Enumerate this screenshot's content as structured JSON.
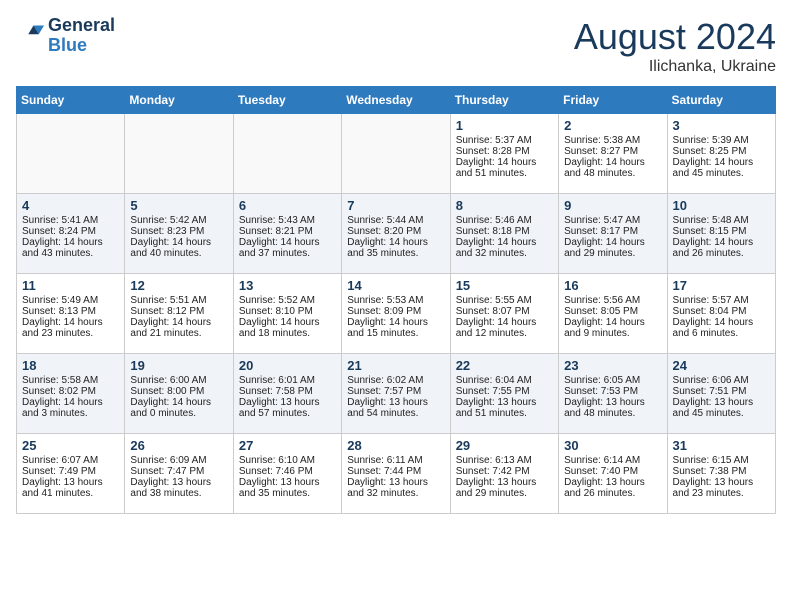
{
  "logo": {
    "line1": "General",
    "line2": "Blue"
  },
  "title": "August 2024",
  "location": "Ilichanka, Ukraine",
  "weekdays": [
    "Sunday",
    "Monday",
    "Tuesday",
    "Wednesday",
    "Thursday",
    "Friday",
    "Saturday"
  ],
  "weeks": [
    [
      {
        "day": "",
        "lines": []
      },
      {
        "day": "",
        "lines": []
      },
      {
        "day": "",
        "lines": []
      },
      {
        "day": "",
        "lines": []
      },
      {
        "day": "1",
        "lines": [
          "Sunrise: 5:37 AM",
          "Sunset: 8:28 PM",
          "Daylight: 14 hours",
          "and 51 minutes."
        ]
      },
      {
        "day": "2",
        "lines": [
          "Sunrise: 5:38 AM",
          "Sunset: 8:27 PM",
          "Daylight: 14 hours",
          "and 48 minutes."
        ]
      },
      {
        "day": "3",
        "lines": [
          "Sunrise: 5:39 AM",
          "Sunset: 8:25 PM",
          "Daylight: 14 hours",
          "and 45 minutes."
        ]
      }
    ],
    [
      {
        "day": "4",
        "lines": [
          "Sunrise: 5:41 AM",
          "Sunset: 8:24 PM",
          "Daylight: 14 hours",
          "and 43 minutes."
        ]
      },
      {
        "day": "5",
        "lines": [
          "Sunrise: 5:42 AM",
          "Sunset: 8:23 PM",
          "Daylight: 14 hours",
          "and 40 minutes."
        ]
      },
      {
        "day": "6",
        "lines": [
          "Sunrise: 5:43 AM",
          "Sunset: 8:21 PM",
          "Daylight: 14 hours",
          "and 37 minutes."
        ]
      },
      {
        "day": "7",
        "lines": [
          "Sunrise: 5:44 AM",
          "Sunset: 8:20 PM",
          "Daylight: 14 hours",
          "and 35 minutes."
        ]
      },
      {
        "day": "8",
        "lines": [
          "Sunrise: 5:46 AM",
          "Sunset: 8:18 PM",
          "Daylight: 14 hours",
          "and 32 minutes."
        ]
      },
      {
        "day": "9",
        "lines": [
          "Sunrise: 5:47 AM",
          "Sunset: 8:17 PM",
          "Daylight: 14 hours",
          "and 29 minutes."
        ]
      },
      {
        "day": "10",
        "lines": [
          "Sunrise: 5:48 AM",
          "Sunset: 8:15 PM",
          "Daylight: 14 hours",
          "and 26 minutes."
        ]
      }
    ],
    [
      {
        "day": "11",
        "lines": [
          "Sunrise: 5:49 AM",
          "Sunset: 8:13 PM",
          "Daylight: 14 hours",
          "and 23 minutes."
        ]
      },
      {
        "day": "12",
        "lines": [
          "Sunrise: 5:51 AM",
          "Sunset: 8:12 PM",
          "Daylight: 14 hours",
          "and 21 minutes."
        ]
      },
      {
        "day": "13",
        "lines": [
          "Sunrise: 5:52 AM",
          "Sunset: 8:10 PM",
          "Daylight: 14 hours",
          "and 18 minutes."
        ]
      },
      {
        "day": "14",
        "lines": [
          "Sunrise: 5:53 AM",
          "Sunset: 8:09 PM",
          "Daylight: 14 hours",
          "and 15 minutes."
        ]
      },
      {
        "day": "15",
        "lines": [
          "Sunrise: 5:55 AM",
          "Sunset: 8:07 PM",
          "Daylight: 14 hours",
          "and 12 minutes."
        ]
      },
      {
        "day": "16",
        "lines": [
          "Sunrise: 5:56 AM",
          "Sunset: 8:05 PM",
          "Daylight: 14 hours",
          "and 9 minutes."
        ]
      },
      {
        "day": "17",
        "lines": [
          "Sunrise: 5:57 AM",
          "Sunset: 8:04 PM",
          "Daylight: 14 hours",
          "and 6 minutes."
        ]
      }
    ],
    [
      {
        "day": "18",
        "lines": [
          "Sunrise: 5:58 AM",
          "Sunset: 8:02 PM",
          "Daylight: 14 hours",
          "and 3 minutes."
        ]
      },
      {
        "day": "19",
        "lines": [
          "Sunrise: 6:00 AM",
          "Sunset: 8:00 PM",
          "Daylight: 14 hours",
          "and 0 minutes."
        ]
      },
      {
        "day": "20",
        "lines": [
          "Sunrise: 6:01 AM",
          "Sunset: 7:58 PM",
          "Daylight: 13 hours",
          "and 57 minutes."
        ]
      },
      {
        "day": "21",
        "lines": [
          "Sunrise: 6:02 AM",
          "Sunset: 7:57 PM",
          "Daylight: 13 hours",
          "and 54 minutes."
        ]
      },
      {
        "day": "22",
        "lines": [
          "Sunrise: 6:04 AM",
          "Sunset: 7:55 PM",
          "Daylight: 13 hours",
          "and 51 minutes."
        ]
      },
      {
        "day": "23",
        "lines": [
          "Sunrise: 6:05 AM",
          "Sunset: 7:53 PM",
          "Daylight: 13 hours",
          "and 48 minutes."
        ]
      },
      {
        "day": "24",
        "lines": [
          "Sunrise: 6:06 AM",
          "Sunset: 7:51 PM",
          "Daylight: 13 hours",
          "and 45 minutes."
        ]
      }
    ],
    [
      {
        "day": "25",
        "lines": [
          "Sunrise: 6:07 AM",
          "Sunset: 7:49 PM",
          "Daylight: 13 hours",
          "and 41 minutes."
        ]
      },
      {
        "day": "26",
        "lines": [
          "Sunrise: 6:09 AM",
          "Sunset: 7:47 PM",
          "Daylight: 13 hours",
          "and 38 minutes."
        ]
      },
      {
        "day": "27",
        "lines": [
          "Sunrise: 6:10 AM",
          "Sunset: 7:46 PM",
          "Daylight: 13 hours",
          "and 35 minutes."
        ]
      },
      {
        "day": "28",
        "lines": [
          "Sunrise: 6:11 AM",
          "Sunset: 7:44 PM",
          "Daylight: 13 hours",
          "and 32 minutes."
        ]
      },
      {
        "day": "29",
        "lines": [
          "Sunrise: 6:13 AM",
          "Sunset: 7:42 PM",
          "Daylight: 13 hours",
          "and 29 minutes."
        ]
      },
      {
        "day": "30",
        "lines": [
          "Sunrise: 6:14 AM",
          "Sunset: 7:40 PM",
          "Daylight: 13 hours",
          "and 26 minutes."
        ]
      },
      {
        "day": "31",
        "lines": [
          "Sunrise: 6:15 AM",
          "Sunset: 7:38 PM",
          "Daylight: 13 hours",
          "and 23 minutes."
        ]
      }
    ]
  ]
}
